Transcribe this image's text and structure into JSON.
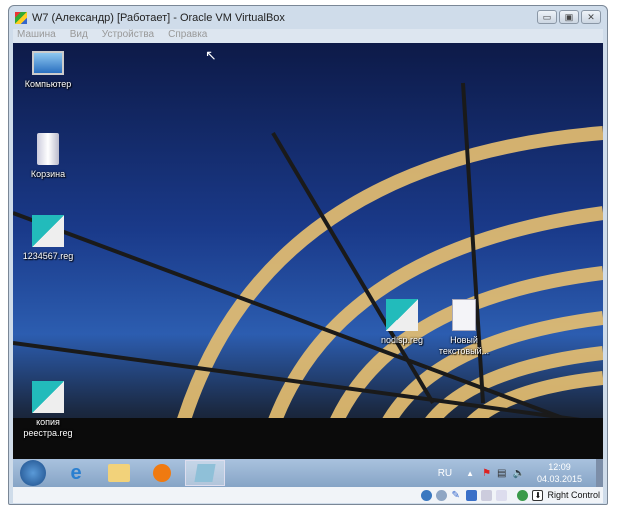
{
  "window": {
    "title": "W7 (Александр) [Работает] - Oracle VM VirtualBox",
    "controls": [
      "minimize",
      "maximize",
      "close"
    ]
  },
  "menu": [
    "Машина",
    "Вид",
    "Устройства",
    "Справка"
  ],
  "desktop_icons": [
    {
      "label": "Компьютер",
      "icon": "computer-icon"
    },
    {
      "label": "Корзина",
      "icon": "recycle-bin-icon"
    },
    {
      "label": "1234567.reg",
      "icon": "reg-file-icon"
    },
    {
      "label": "копия реестра.reg",
      "icon": "reg-file-icon"
    },
    {
      "label": "nodisp.reg",
      "icon": "reg-file-icon"
    },
    {
      "label": "Новый текстовый...",
      "icon": "text-file-icon"
    }
  ],
  "taskbar": {
    "items": [
      "start-icon",
      "internet-explorer-icon",
      "explorer-icon",
      "media-player-icon",
      "notepad-icon"
    ],
    "lang": "RU",
    "time": "12:09",
    "date": "04.03.2015"
  },
  "statusbar": {
    "host_key": "Right Control"
  }
}
